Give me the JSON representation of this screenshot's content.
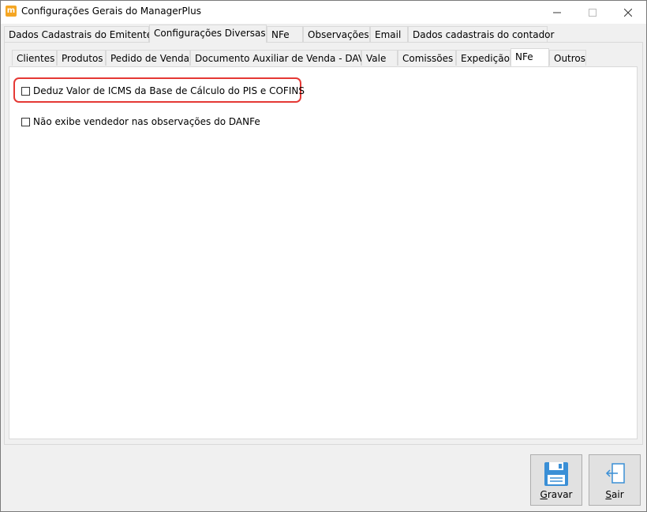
{
  "window": {
    "title": "Configurações Gerais do ManagerPlus",
    "app_icon_letter": "m"
  },
  "main_tabs": [
    {
      "label": "Dados Cadastrais do Emitente"
    },
    {
      "label": "Configurações Diversas",
      "active": true
    },
    {
      "label": "NFe"
    },
    {
      "label": "Observações"
    },
    {
      "label": "Email"
    },
    {
      "label": "Dados cadastrais do contador"
    }
  ],
  "sub_tabs": [
    {
      "label": "Clientes"
    },
    {
      "label": "Produtos"
    },
    {
      "label": "Pedido de Venda"
    },
    {
      "label": "Documento Auxiliar de Venda - DAV"
    },
    {
      "label": "Vale"
    },
    {
      "label": "Comissões"
    },
    {
      "label": "Expedição"
    },
    {
      "label": "NFe",
      "active": true
    },
    {
      "label": "Outros"
    }
  ],
  "options": [
    {
      "label": "Deduz Valor de ICMS da Base de Cálculo do PIS e COFINS",
      "checked": false,
      "highlighted": true
    },
    {
      "label": "Não exibe vendedor nas observações do DANFe",
      "checked": false
    }
  ],
  "buttons": {
    "save": {
      "label": "Gravar",
      "icon": "floppy-disk-icon"
    },
    "exit": {
      "label": "Sair",
      "icon": "exit-door-icon"
    }
  },
  "colors": {
    "highlight": "#e53935",
    "save_icon": "#3a8fd6",
    "app_icon": "#f5a623"
  }
}
